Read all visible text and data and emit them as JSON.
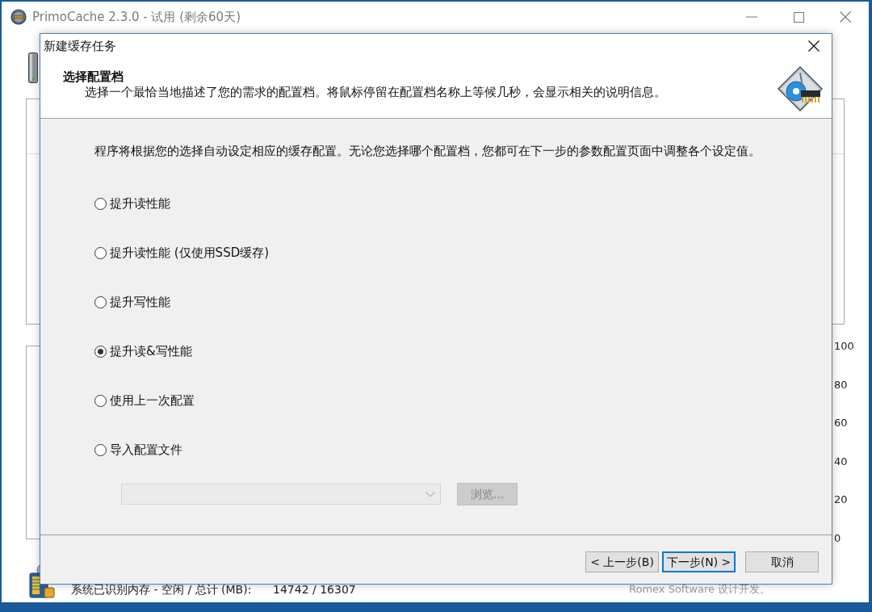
{
  "main_window": {
    "title": "PrimoCache 2.3.0 - 试用 (剩余60天)",
    "graph": {
      "y_labels": [
        "100",
        "80",
        "60",
        "40",
        "20",
        "0"
      ]
    },
    "status_bar": {
      "memory_label": "系统已识别内存 - 空闲 / 总计 (MB):",
      "memory_value": "14742 / 16307",
      "credit": "Romex Software 设计开发。"
    }
  },
  "dialog": {
    "title": "新建缓存任务",
    "header": {
      "title": "选择配置档",
      "description": "选择一个最恰当地描述了您的需求的配置档。将鼠标停留在配置档名称上等候几秒，会显示相关的说明信息。"
    },
    "intro": "程序将根据您的选择自动设定相应的缓存配置。无论您选择哪个配置档，您都可在下一步的参数配置页面中调整各个设定值。",
    "profiles": [
      {
        "label": "提升读性能",
        "selected": false
      },
      {
        "label": "提升读性能 (仅使用SSD缓存)",
        "selected": false
      },
      {
        "label": "提升写性能",
        "selected": false
      },
      {
        "label": "提升读&写性能",
        "selected": true
      },
      {
        "label": "使用上一次配置",
        "selected": false
      },
      {
        "label": "导入配置文件",
        "selected": false
      }
    ],
    "config_file": {
      "disabled": true
    },
    "browse_button": {
      "label": "浏览...",
      "disabled": true
    },
    "nav_buttons": [
      {
        "label": "< 上一步(B)",
        "focused": false
      },
      {
        "label": "下一步(N) >",
        "focused": true
      }
    ],
    "cancel_button": {
      "label": "取消",
      "focused": false
    }
  }
}
